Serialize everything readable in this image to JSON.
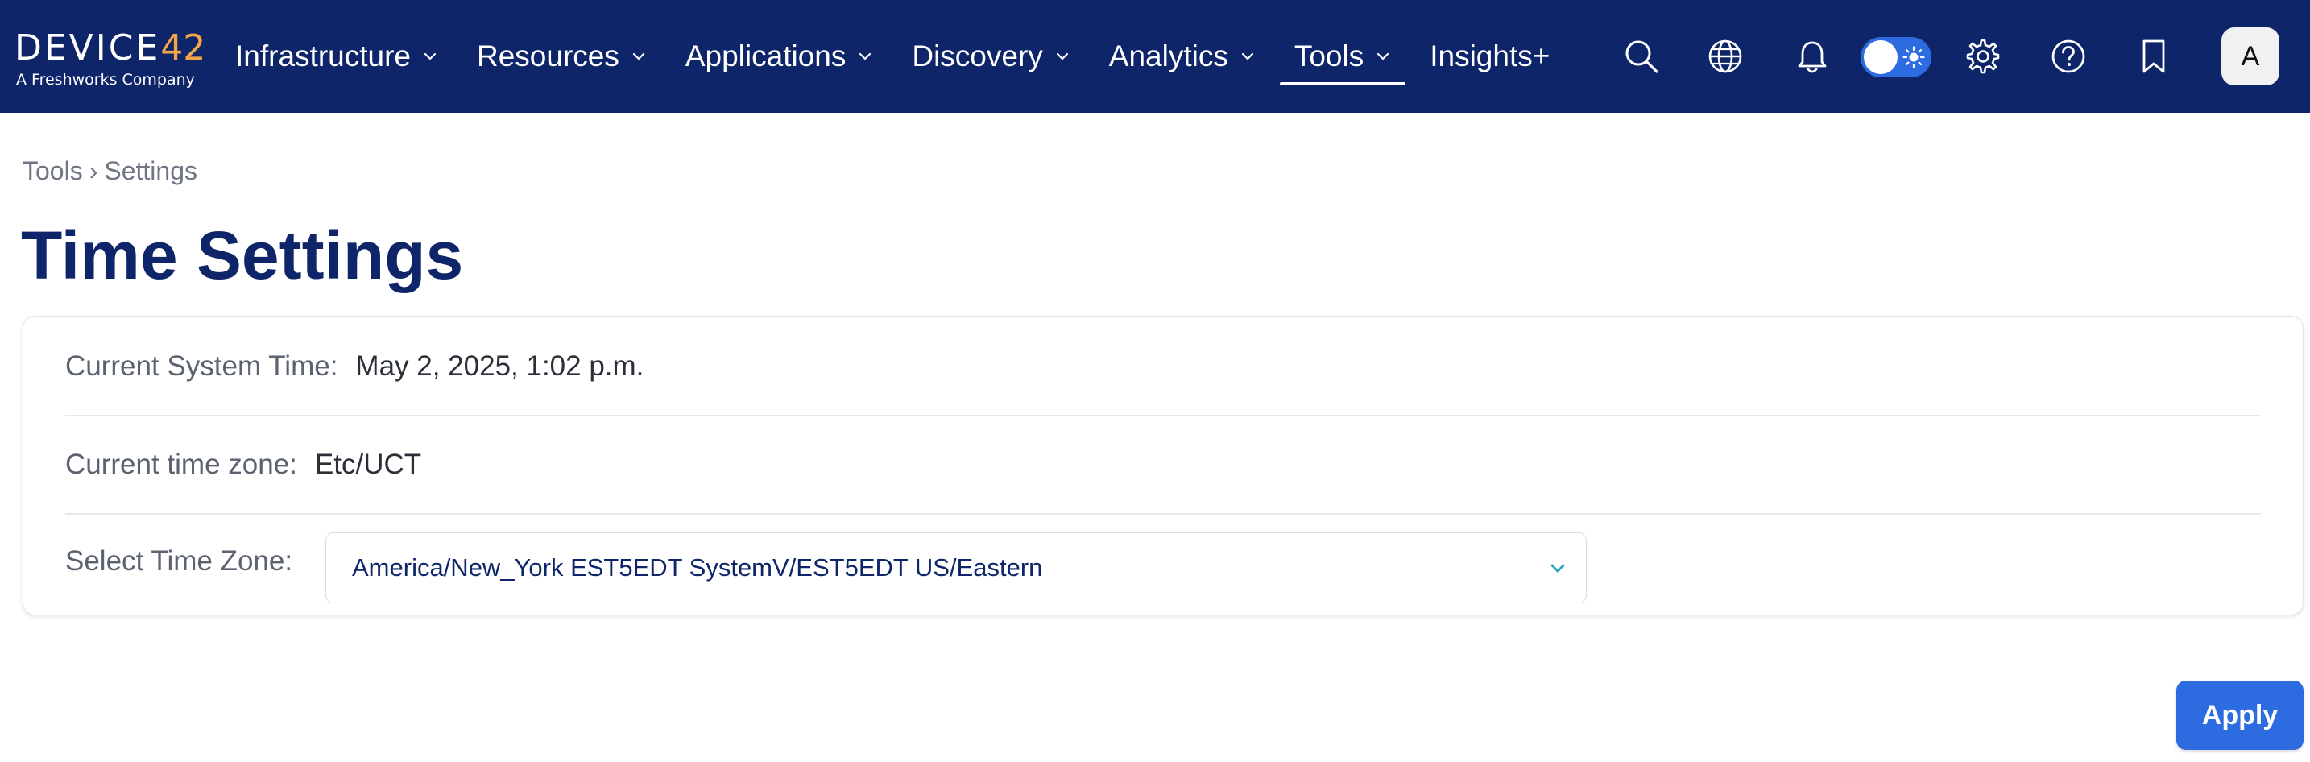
{
  "brand": {
    "name_part1": "DEVICE",
    "name_part2": "42",
    "tagline": "A Freshworks Company",
    "accent_color": "#f3a54a"
  },
  "colors": {
    "navbar_bg": "#0e2569",
    "primary": "#2d6be0",
    "title": "#0e2569"
  },
  "nav": {
    "items": [
      {
        "label": "Infrastructure",
        "has_dropdown": true
      },
      {
        "label": "Resources",
        "has_dropdown": true
      },
      {
        "label": "Applications",
        "has_dropdown": true
      },
      {
        "label": "Discovery",
        "has_dropdown": true
      },
      {
        "label": "Analytics",
        "has_dropdown": true
      },
      {
        "label": "Tools",
        "has_dropdown": true,
        "active": true
      },
      {
        "label": "Insights+",
        "has_dropdown": false
      }
    ],
    "icons": [
      "search-icon",
      "globe-icon",
      "bell-icon",
      "theme-toggle",
      "gear-icon",
      "help-icon",
      "bookmark-icon"
    ],
    "avatar_initial": "A"
  },
  "breadcrumb": {
    "parent": "Tools",
    "separator": "›",
    "current": "Settings"
  },
  "page": {
    "title": "Time Settings"
  },
  "settings": {
    "system_time_label": "Current System Time:",
    "system_time_value": "May 2, 2025, 1:02 p.m.",
    "time_zone_label": "Current time zone:",
    "time_zone_value": "Etc/UCT",
    "select_label": "Select Time Zone:",
    "select_value": "America/New_York EST5EDT SystemV/EST5EDT US/Eastern"
  },
  "actions": {
    "apply_label": "Apply"
  }
}
